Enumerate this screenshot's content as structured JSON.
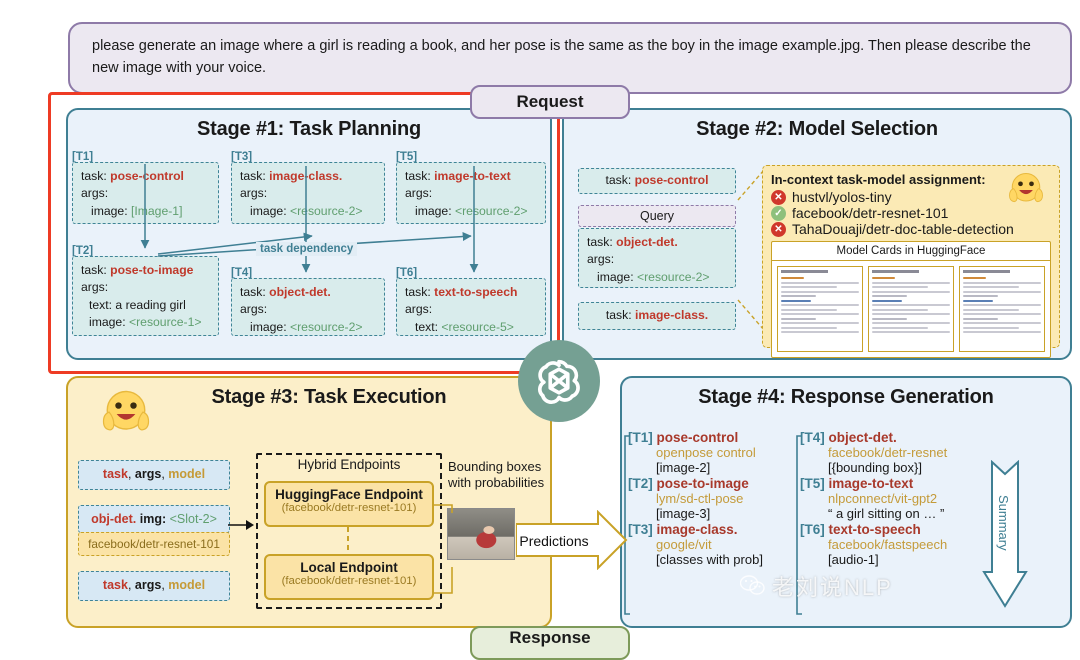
{
  "request": {
    "text": "please generate an image where a girl is reading a book, and her pose is the same as the boy in the image example.jpg. Then please describe the new image with your voice.",
    "chip_label": "Request"
  },
  "response": {
    "chip_label": "Response"
  },
  "colors": {
    "accent_teal": "#3f7f93",
    "task_red": "#c0392b",
    "model_gold": "#c49b3a",
    "resource_green": "#5f9e6e",
    "highlight_red": "#ee3b24",
    "stage3_bg": "#fcefc9",
    "stage_bg": "#eaf2fa",
    "request_bg": "#ece8f1",
    "openai_green": "#75a093"
  },
  "stage1": {
    "title": "Stage #1: Task Planning",
    "dependency_label": "task dependency",
    "tasks": [
      {
        "tag": "[T1]",
        "task_label": "task:",
        "task": "pose-control",
        "args_label": "args:",
        "args": [
          {
            "key": "image:",
            "value": "[Image-1]",
            "value_kind": "resource"
          }
        ]
      },
      {
        "tag": "[T3]",
        "task_label": "task:",
        "task": "image-class.",
        "args_label": "args:",
        "args": [
          {
            "key": "image:",
            "value": "<resource-2>",
            "value_kind": "resource"
          }
        ]
      },
      {
        "tag": "[T5]",
        "task_label": "task:",
        "task": "image-to-text",
        "args_label": "args:",
        "args": [
          {
            "key": "image:",
            "value": "<resource-2>",
            "value_kind": "resource"
          }
        ]
      },
      {
        "tag": "[T2]",
        "task_label": "task:",
        "task": "pose-to-image",
        "args_label": "args:",
        "args": [
          {
            "key": "text:",
            "value": "a reading girl",
            "value_kind": "plain"
          },
          {
            "key": "image:",
            "value": "<resource-1>",
            "value_kind": "resource"
          }
        ]
      },
      {
        "tag": "[T4]",
        "task_label": "task:",
        "task": "object-det.",
        "args_label": "args:",
        "args": [
          {
            "key": "image:",
            "value": "<resource-2>",
            "value_kind": "resource"
          }
        ]
      },
      {
        "tag": "[T6]",
        "task_label": "task:",
        "task": "text-to-speech",
        "args_label": "args:",
        "args": [
          {
            "key": "text:",
            "value": "<resource-5>",
            "value_kind": "resource"
          }
        ]
      }
    ]
  },
  "stage2": {
    "title": "Stage #2: Model Selection",
    "left_cards": {
      "top": {
        "task_label": "task:",
        "task": "pose-control"
      },
      "query_title": "Query",
      "query_task_label": "task:",
      "query_task": "object-det.",
      "query_args_label": "args:",
      "query_arg_key": "image:",
      "query_arg_value": "<resource-2>",
      "bottom": {
        "task_label": "task:",
        "task": "image-class."
      }
    },
    "assignment": {
      "heading": "In-context task-model assignment:",
      "icon": "hugging-face-emoji",
      "candidates": [
        {
          "status": "rejected",
          "name": "hustvl/yolos-tiny"
        },
        {
          "status": "selected",
          "name": "facebook/detr-resnet-101"
        },
        {
          "status": "rejected",
          "name": "TahaDouaji/detr-doc-table-detection"
        }
      ],
      "model_cards_title": "Model Cards in HuggingFace"
    }
  },
  "stage3": {
    "title": "Stage #3: Task Execution",
    "icon": "hugging-face-emoji",
    "left_cards": [
      {
        "kind": "triple",
        "parts": [
          "task",
          "args",
          "model"
        ]
      },
      {
        "kind": "detail",
        "task": "obj-det.",
        "arg_key": "img:",
        "arg_value": "<Slot-2>"
      },
      {
        "kind": "model",
        "model": "facebook/detr-resnet-101"
      },
      {
        "kind": "triple",
        "parts": [
          "task",
          "args",
          "model"
        ]
      }
    ],
    "hybrid_title": "Hybrid Endpoints",
    "endpoints": [
      {
        "name": "HuggingFace Endpoint",
        "model": "(facebook/detr-resnet-101)"
      },
      {
        "name": "Local Endpoint",
        "model": "(facebook/detr-resnet-101)"
      }
    ],
    "bounding_caption_line1": "Bounding boxes",
    "bounding_caption_line2": "with probabilities",
    "photo_alt": "girl-reading-book-photo",
    "predictions_label": "Predictions"
  },
  "stage4": {
    "title": "Stage #4: Response Generation",
    "summary_label": "Summary",
    "results_left": [
      {
        "tag": "[T1]",
        "task": "pose-control",
        "model": "openpose control",
        "output": "[image-2]"
      },
      {
        "tag": "[T2]",
        "task": "pose-to-image",
        "model": "lym/sd-ctl-pose",
        "output": "[image-3]"
      },
      {
        "tag": "[T3]",
        "task": "image-class.",
        "model": "google/vit",
        "output": "[classes with prob]"
      }
    ],
    "results_right": [
      {
        "tag": "[T4]",
        "task": "object-det.",
        "model": "facebook/detr-resnet",
        "output": "[{bounding box}]"
      },
      {
        "tag": "[T5]",
        "task": "image-to-text",
        "model": "nlpconnect/vit-gpt2",
        "output": "“ a girl sitting on … ”"
      },
      {
        "tag": "[T6]",
        "task": "text-to-speech",
        "model": "facebook/fastspeech",
        "output": "[audio-1]"
      }
    ]
  },
  "watermark": {
    "text": "老刘说NLP",
    "icon": "wechat-icon"
  }
}
